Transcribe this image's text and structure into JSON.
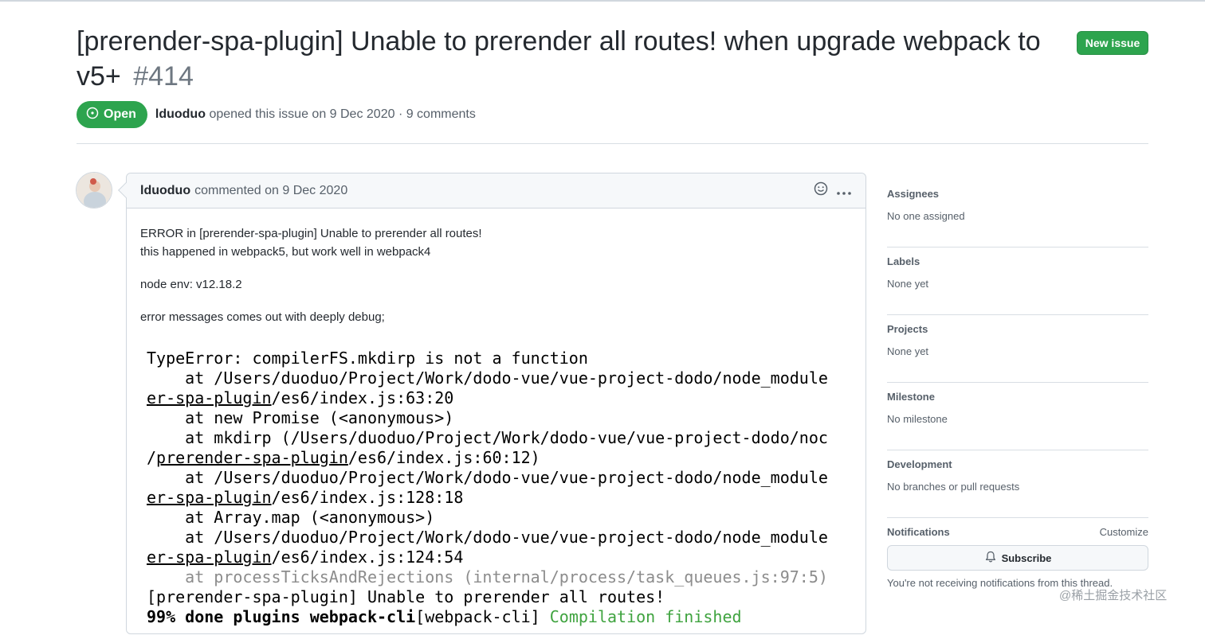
{
  "issue": {
    "title": "[prerender-spa-plugin] Unable to prerender all routes! when upgrade webpack to v5+",
    "number": "#414",
    "state": "Open",
    "author": "lduoduo",
    "meta_rest": "opened this issue on 9 Dec 2020 · 9 comments"
  },
  "header": {
    "new_issue_label": "New issue"
  },
  "comment": {
    "author": "lduoduo",
    "meta": "commented on 9 Dec 2020",
    "body": {
      "line1": "ERROR in [prerender-spa-plugin] Unable to prerender all routes!",
      "line2": "this happened in webpack5, but work well in webpack4",
      "line3": "node env: v12.18.2",
      "line4": "error messages comes out with deeply debug;"
    },
    "code": {
      "l1": "TypeError: compilerFS.mkdirp is not a function",
      "l2": "    at /Users/duoduo/Project/Work/dodo-vue/vue-project-dodo/node_module",
      "l3a": "er-spa-plugin",
      "l3b": "/es6/index.js:63:20",
      "l4": "    at new Promise (<anonymous>)",
      "l5": "    at mkdirp (/Users/duoduo/Project/Work/dodo-vue/vue-project-dodo/noc",
      "l6a": "/",
      "l6b": "prerender-spa-plugin",
      "l6c": "/es6/index.js:60:12)",
      "l7": "    at /Users/duoduo/Project/Work/dodo-vue/vue-project-dodo/node_module",
      "l8a": "er-spa-plugin",
      "l8b": "/es6/index.js:128:18",
      "l9": "    at Array.map (<anonymous>)",
      "l10": "    at /Users/duoduo/Project/Work/dodo-vue/vue-project-dodo/node_module",
      "l11a": "er-spa-plugin",
      "l11b": "/es6/index.js:124:54",
      "l12": "    at processTicksAndRejections (internal/process/task_queues.js:97:5)",
      "l13": "[prerender-spa-plugin] Unable to prerender all routes!",
      "l14a": "99% done plugins webpack-cli",
      "l14b": "[webpack-cli] ",
      "l14c": "Compilation finished"
    }
  },
  "sidebar": {
    "assignees": {
      "label": "Assignees",
      "value": "No one assigned"
    },
    "labels": {
      "label": "Labels",
      "value": "None yet"
    },
    "projects": {
      "label": "Projects",
      "value": "None yet"
    },
    "milestone": {
      "label": "Milestone",
      "value": "No milestone"
    },
    "development": {
      "label": "Development",
      "value": "No branches or pull requests"
    },
    "notifications": {
      "label": "Notifications",
      "customize": "Customize",
      "subscribe_label": "Subscribe",
      "note": "You're not receiving notifications from this thread."
    }
  },
  "watermark": "@稀土掘金技术社区",
  "colors": {
    "open_green": "#2da44e",
    "text": "#24292f",
    "muted": "#57606a"
  },
  "icons": [
    "issue-opened-icon",
    "smiley-icon",
    "kebab-horizontal-icon",
    "bell-icon"
  ]
}
